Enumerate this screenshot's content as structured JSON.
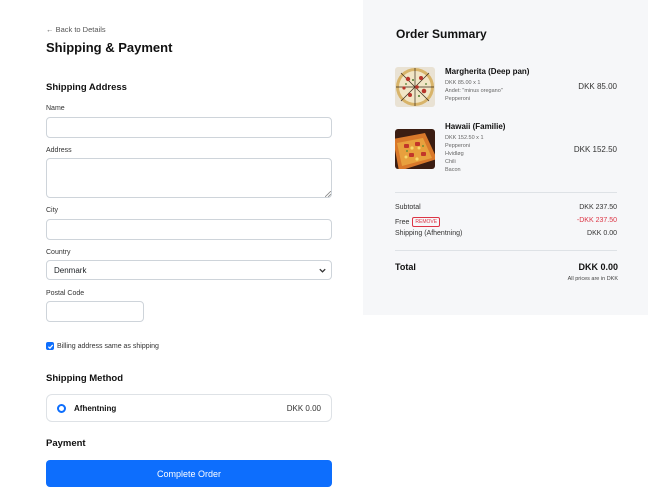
{
  "checkout": {
    "back_link": "← Back to Details",
    "title": "Shipping & Payment",
    "shipping_address": {
      "section_title": "Shipping Address",
      "name_label": "Name",
      "name_value": "",
      "address_label": "Address",
      "address_value": "",
      "city_label": "City",
      "city_value": "",
      "country_label": "Country",
      "country_value": "Denmark",
      "postal_label": "Postal Code",
      "postal_value": ""
    },
    "billing_same_label": "Billing address same as shipping",
    "billing_same_checked": true,
    "shipping_method": {
      "section_title": "Shipping Method",
      "option_name": "Afhentning",
      "option_price": "DKK 0.00",
      "selected": true
    },
    "payment": {
      "section_title": "Payment"
    },
    "complete_button": "Complete Order"
  },
  "summary": {
    "title": "Order Summary",
    "items": [
      {
        "name": "Margherita (Deep pan)",
        "qty_line": "DKK 85.00 x 1",
        "details": [
          "Andet: \"minus oregano\"",
          "Pepperoni"
        ],
        "price": "DKK 85.00",
        "thumb_icon": "pizza-margherita-image"
      },
      {
        "name": "Hawaii (Familie)",
        "qty_line": "DKK 152.50 x 1",
        "details": [
          "Pepperoni",
          "Hvidløg",
          "Chili",
          "Bacon"
        ],
        "price": "DKK 152.50",
        "thumb_icon": "pizza-hawaii-image"
      }
    ],
    "subtotal_label": "Subtotal",
    "subtotal_value": "DKK 237.50",
    "free_label": "Free",
    "remove_label": "REMOVE",
    "free_value": "-DKK 237.50",
    "shipping_label": "Shipping (Afhentning)",
    "shipping_value": "DKK 0.00",
    "total_label": "Total",
    "total_value": "DKK 0.00",
    "total_note": "All prices are in DKK"
  },
  "colors": {
    "accent": "#0d6efd",
    "danger": "#dc3545",
    "summary_bg": "#f6f7f9"
  }
}
